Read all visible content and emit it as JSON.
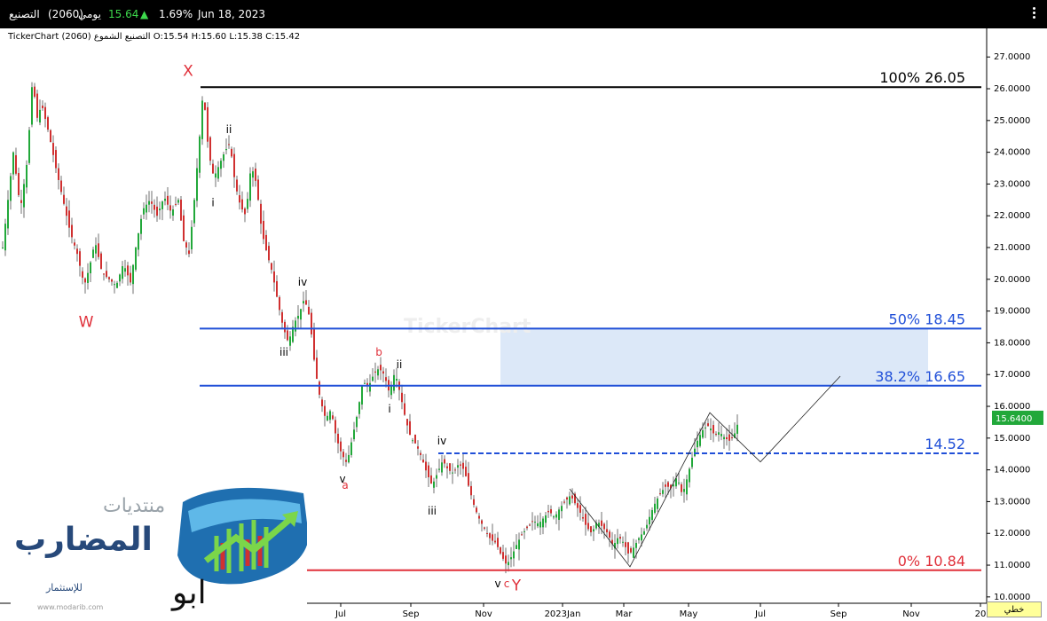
{
  "header": {
    "name": "التصنيع",
    "code": "(2060)",
    "period": "يومي",
    "price": "15.64",
    "arrow": "▲",
    "change": "1.69%",
    "date": "Jun 18, 2023"
  },
  "legend": {
    "text": "TickerChart التصنيع الشموع (2060) O:15.54 H:15.60 L:15.38 C:15.42"
  },
  "watermark": "TickerChart",
  "bottom_button": "خطي",
  "logo": {
    "line1": "منتديات",
    "line2": "المضارب",
    "line3": "للإستثمار",
    "site": "www.modarib.com",
    "signature": "ابو مسعود"
  },
  "chart_data": {
    "type": "candlestick",
    "x_tick_labels": [
      "Jul",
      "Sep",
      "Nov",
      "2023Jan",
      "Mar",
      "May",
      "Jul",
      "Sep",
      "Nov",
      "20"
    ],
    "y_ticks": [
      "27.0000",
      "26.0000",
      "25.0000",
      "24.0000",
      "23.0000",
      "22.0000",
      "21.0000",
      "20.0000",
      "19.0000",
      "18.0000",
      "17.0000",
      "16.0000",
      "15.0000",
      "14.0000",
      "13.0000",
      "12.0000",
      "11.0000",
      "10.0000"
    ],
    "ylim": [
      9.8,
      27.9
    ],
    "last_price": "15.6400",
    "price_path": [
      {
        "t": 0,
        "p": 21.0
      },
      {
        "t": 6,
        "p": 22.5
      },
      {
        "t": 12,
        "p": 24.0
      },
      {
        "t": 20,
        "p": 22.2
      },
      {
        "t": 28,
        "p": 23.8
      },
      {
        "t": 34,
        "p": 26.5
      },
      {
        "t": 38,
        "p": 25.0
      },
      {
        "t": 44,
        "p": 25.5
      },
      {
        "t": 52,
        "p": 24.6
      },
      {
        "t": 60,
        "p": 23.5
      },
      {
        "t": 68,
        "p": 22.5
      },
      {
        "t": 76,
        "p": 21.5
      },
      {
        "t": 84,
        "p": 20.8
      },
      {
        "t": 92,
        "p": 19.8
      },
      {
        "t": 98,
        "p": 20.4
      },
      {
        "t": 104,
        "p": 21.2
      },
      {
        "t": 112,
        "p": 20.2
      },
      {
        "t": 120,
        "p": 20.0
      },
      {
        "t": 128,
        "p": 19.8
      },
      {
        "t": 136,
        "p": 20.5
      },
      {
        "t": 144,
        "p": 19.9
      },
      {
        "t": 150,
        "p": 21.0
      },
      {
        "t": 158,
        "p": 22.2
      },
      {
        "t": 166,
        "p": 22.5
      },
      {
        "t": 174,
        "p": 22.0
      },
      {
        "t": 182,
        "p": 22.6
      },
      {
        "t": 190,
        "p": 22.1
      },
      {
        "t": 198,
        "p": 22.5
      },
      {
        "t": 204,
        "p": 21.2
      },
      {
        "t": 210,
        "p": 20.8
      },
      {
        "t": 216,
        "p": 22.5
      },
      {
        "t": 222,
        "p": 24.5
      },
      {
        "t": 226,
        "p": 26.0
      },
      {
        "t": 232,
        "p": 24.0
      },
      {
        "t": 238,
        "p": 23.2
      },
      {
        "t": 244,
        "p": 23.6
      },
      {
        "t": 250,
        "p": 24.0
      },
      {
        "t": 256,
        "p": 24.3
      },
      {
        "t": 262,
        "p": 23.0
      },
      {
        "t": 268,
        "p": 22.3
      },
      {
        "t": 274,
        "p": 22.0
      },
      {
        "t": 280,
        "p": 23.6
      },
      {
        "t": 286,
        "p": 23.0
      },
      {
        "t": 292,
        "p": 21.5
      },
      {
        "t": 298,
        "p": 20.8
      },
      {
        "t": 304,
        "p": 20.2
      },
      {
        "t": 310,
        "p": 19.3
      },
      {
        "t": 316,
        "p": 18.5
      },
      {
        "t": 322,
        "p": 18.0
      },
      {
        "t": 328,
        "p": 18.6
      },
      {
        "t": 334,
        "p": 18.9
      },
      {
        "t": 340,
        "p": 19.4
      },
      {
        "t": 346,
        "p": 18.8
      },
      {
        "t": 352,
        "p": 17.2
      },
      {
        "t": 358,
        "p": 16.2
      },
      {
        "t": 364,
        "p": 15.6
      },
      {
        "t": 370,
        "p": 15.9
      },
      {
        "t": 376,
        "p": 15.0
      },
      {
        "t": 382,
        "p": 14.5
      },
      {
        "t": 388,
        "p": 14.2
      },
      {
        "t": 394,
        "p": 15.0
      },
      {
        "t": 400,
        "p": 15.8
      },
      {
        "t": 406,
        "p": 16.8
      },
      {
        "t": 412,
        "p": 16.6
      },
      {
        "t": 418,
        "p": 17.0
      },
      {
        "t": 424,
        "p": 17.2
      },
      {
        "t": 430,
        "p": 17.0
      },
      {
        "t": 436,
        "p": 16.4
      },
      {
        "t": 442,
        "p": 17.1
      },
      {
        "t": 448,
        "p": 16.4
      },
      {
        "t": 454,
        "p": 15.6
      },
      {
        "t": 460,
        "p": 15.0
      },
      {
        "t": 466,
        "p": 14.8
      },
      {
        "t": 472,
        "p": 14.4
      },
      {
        "t": 478,
        "p": 13.9
      },
      {
        "t": 484,
        "p": 13.5
      },
      {
        "t": 490,
        "p": 13.9
      },
      {
        "t": 496,
        "p": 14.3
      },
      {
        "t": 502,
        "p": 14.0
      },
      {
        "t": 508,
        "p": 13.9
      },
      {
        "t": 514,
        "p": 14.2
      },
      {
        "t": 520,
        "p": 14.0
      },
      {
        "t": 526,
        "p": 13.4
      },
      {
        "t": 532,
        "p": 12.8
      },
      {
        "t": 538,
        "p": 12.4
      },
      {
        "t": 544,
        "p": 12.1
      },
      {
        "t": 550,
        "p": 11.8
      },
      {
        "t": 556,
        "p": 11.7
      },
      {
        "t": 562,
        "p": 11.3
      },
      {
        "t": 568,
        "p": 11.0
      },
      {
        "t": 574,
        "p": 11.3
      },
      {
        "t": 580,
        "p": 11.7
      },
      {
        "t": 586,
        "p": 12.0
      },
      {
        "t": 592,
        "p": 12.2
      },
      {
        "t": 598,
        "p": 12.4
      },
      {
        "t": 604,
        "p": 12.3
      },
      {
        "t": 610,
        "p": 12.5
      },
      {
        "t": 616,
        "p": 12.7
      },
      {
        "t": 622,
        "p": 12.5
      },
      {
        "t": 628,
        "p": 12.8
      },
      {
        "t": 634,
        "p": 13.0
      },
      {
        "t": 640,
        "p": 13.2
      },
      {
        "t": 646,
        "p": 12.9
      },
      {
        "t": 652,
        "p": 12.6
      },
      {
        "t": 658,
        "p": 12.2
      },
      {
        "t": 664,
        "p": 12.0
      },
      {
        "t": 670,
        "p": 12.4
      },
      {
        "t": 676,
        "p": 12.2
      },
      {
        "t": 682,
        "p": 12.0
      },
      {
        "t": 688,
        "p": 11.6
      },
      {
        "t": 694,
        "p": 11.9
      },
      {
        "t": 700,
        "p": 11.7
      },
      {
        "t": 706,
        "p": 11.3
      },
      {
        "t": 712,
        "p": 11.6
      },
      {
        "t": 718,
        "p": 11.9
      },
      {
        "t": 724,
        "p": 12.1
      },
      {
        "t": 730,
        "p": 12.6
      },
      {
        "t": 736,
        "p": 13.0
      },
      {
        "t": 742,
        "p": 13.3
      },
      {
        "t": 748,
        "p": 13.5
      },
      {
        "t": 754,
        "p": 13.4
      },
      {
        "t": 760,
        "p": 13.8
      },
      {
        "t": 766,
        "p": 13.2
      },
      {
        "t": 772,
        "p": 13.8
      },
      {
        "t": 778,
        "p": 14.5
      },
      {
        "t": 784,
        "p": 15.0
      },
      {
        "t": 790,
        "p": 15.3
      },
      {
        "t": 796,
        "p": 15.4
      },
      {
        "t": 802,
        "p": 15.1
      },
      {
        "t": 808,
        "p": 15.2
      },
      {
        "t": 814,
        "p": 15.0
      },
      {
        "t": 820,
        "p": 14.9
      },
      {
        "t": 826,
        "p": 15.2
      },
      {
        "t": 830,
        "p": 15.64
      }
    ],
    "levels": [
      {
        "label": "100%  26.05",
        "value": 26.05,
        "color": "#000000",
        "style": "solid",
        "label_color": "#000000"
      },
      {
        "label": "50%  18.45",
        "value": 18.45,
        "color": "#2150d8",
        "style": "solid",
        "label_color": "#2150d8"
      },
      {
        "label": "38.2%  16.65",
        "value": 16.65,
        "color": "#2150d8",
        "style": "solid",
        "label_color": "#2150d8"
      },
      {
        "label": "14.52",
        "value": 14.52,
        "color": "#2150d8",
        "style": "dashed",
        "label_color": "#2150d8"
      },
      {
        "label": "0%  10.84",
        "value": 10.84,
        "color": "#e0303a",
        "style": "solid",
        "label_color": "#e0303a"
      }
    ],
    "target_zone": {
      "from": 16.65,
      "to": 18.45,
      "color": "#dce8f8"
    },
    "wave_labels": [
      {
        "text": "W",
        "t": 95,
        "p": 18.5,
        "color": "#e0303a"
      },
      {
        "text": "X",
        "t": 210,
        "p": 26.4,
        "color": "#e0303a"
      },
      {
        "text": "ii",
        "t": 256,
        "p": 24.6,
        "color": "#000000"
      },
      {
        "text": "i",
        "t": 238,
        "p": 22.3,
        "color": "#000000"
      },
      {
        "text": "iv",
        "t": 339,
        "p": 19.8,
        "color": "#000000"
      },
      {
        "text": "iii",
        "t": 318,
        "p": 17.6,
        "color": "#000000"
      },
      {
        "text": "v",
        "t": 384,
        "p": 13.6,
        "color": "#000000"
      },
      {
        "text": "a",
        "t": 387,
        "p": 13.4,
        "color": "#e0303a"
      },
      {
        "text": "b",
        "t": 425,
        "p": 17.6,
        "color": "#e0303a"
      },
      {
        "text": "ii",
        "t": 448,
        "p": 17.2,
        "color": "#000000"
      },
      {
        "text": "i",
        "t": 437,
        "p": 15.8,
        "color": "#000000"
      },
      {
        "text": "iv",
        "t": 496,
        "p": 14.8,
        "color": "#000000"
      },
      {
        "text": "iii",
        "t": 485,
        "p": 12.6,
        "color": "#000000"
      },
      {
        "text": "v",
        "t": 559,
        "p": 10.3,
        "color": "#000000"
      },
      {
        "text": "c",
        "t": 569,
        "p": 10.3,
        "color": "#e0303a"
      },
      {
        "text": "Y",
        "t": 580,
        "p": 10.2,
        "color": "#e0303a"
      }
    ],
    "projection": [
      {
        "t": 640,
        "p": 13.4
      },
      {
        "t": 708,
        "p": 10.95
      },
      {
        "t": 798,
        "p": 15.8
      },
      {
        "t": 855,
        "p": 14.25
      },
      {
        "t": 945,
        "p": 16.95
      }
    ],
    "colors": {
      "up": "#22a83a",
      "down": "#d03030",
      "wick": "#333333"
    }
  }
}
